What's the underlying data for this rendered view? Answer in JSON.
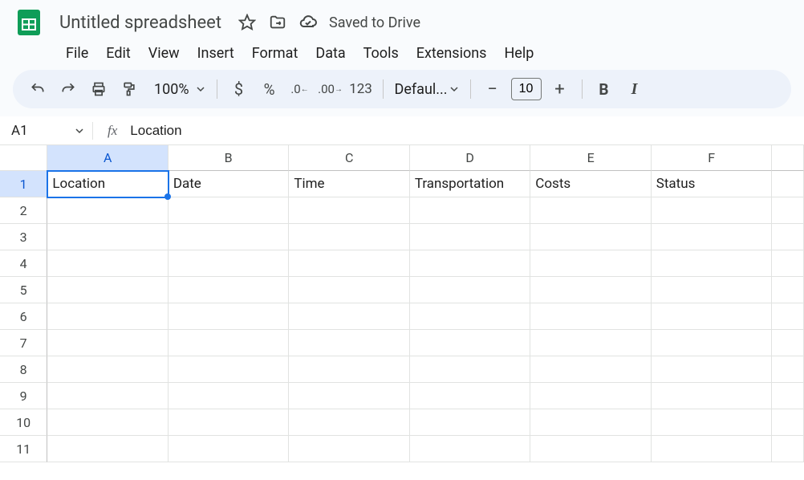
{
  "header": {
    "title": "Untitled spreadsheet",
    "saved": "Saved to Drive"
  },
  "menu": [
    "File",
    "Edit",
    "View",
    "Insert",
    "Format",
    "Data",
    "Tools",
    "Extensions",
    "Help"
  ],
  "toolbar": {
    "zoom": "100%",
    "number_123": "123",
    "font": "Defaul...",
    "font_size": "10"
  },
  "namebox": {
    "ref": "A1",
    "formula": "Location"
  },
  "columns": [
    "A",
    "B",
    "C",
    "D",
    "E",
    "F"
  ],
  "active_col": "A",
  "rows": [
    "1",
    "2",
    "3",
    "4",
    "5",
    "6",
    "7",
    "8",
    "9",
    "10",
    "11"
  ],
  "active_row": "1",
  "cells": {
    "r1": [
      "Location",
      "Date",
      "Time",
      "Transportation",
      "Costs",
      "Status"
    ]
  }
}
